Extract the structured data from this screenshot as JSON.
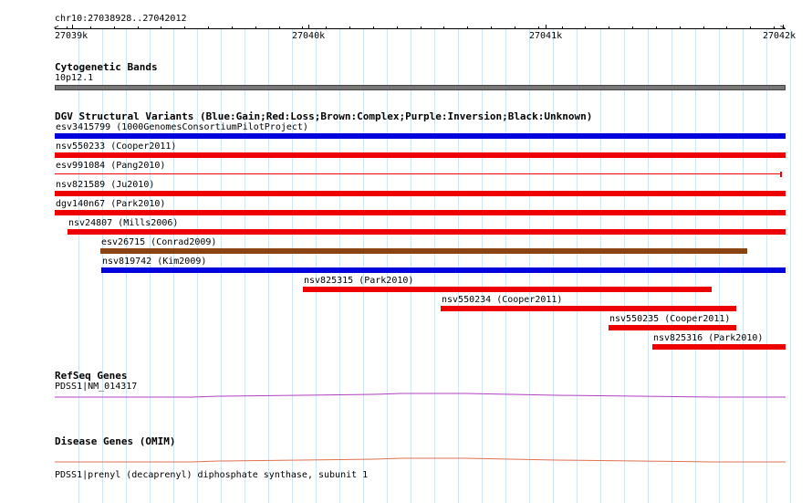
{
  "locus": "chr10:27038928..27042012",
  "ruler": {
    "ticks": [
      {
        "label": "27039k",
        "pos": 27039000
      },
      {
        "label": "27040k",
        "pos": 27040000
      },
      {
        "label": "27041k",
        "pos": 27041000
      },
      {
        "label": "27042k",
        "pos": 27042000
      }
    ],
    "start": 27038928,
    "end": 27042012
  },
  "cytobands": {
    "title": "Cytogenetic Bands",
    "band": "10p12.1",
    "color": "#777777"
  },
  "dgv": {
    "title": "DGV Structural Variants (Blue:Gain;Red:Loss;Brown:Complex;Purple:Inversion;Black:Unknown)",
    "colors": {
      "gain": "#0000dd",
      "loss": "#ee0000",
      "complex": "#8b4513"
    },
    "variants": [
      {
        "label": "esv3415799 (1000GenomesConsortiumPilotProject)",
        "type": "gain",
        "start": 27038928,
        "end": 27042012
      },
      {
        "label": "nsv550233 (Cooper2011)",
        "type": "loss",
        "start": 27038928,
        "end": 27042012
      },
      {
        "label": "esv991084 (Pang2010)",
        "type": "loss-thin",
        "start": 27038928,
        "end": 27041992
      },
      {
        "label": "nsv821589 (Ju2010)",
        "type": "loss",
        "start": 27038928,
        "end": 27042012
      },
      {
        "label": "dgv140n67 (Park2010)",
        "type": "loss",
        "start": 27038928,
        "end": 27042012
      },
      {
        "label": "nsv24807 (Mills2006)",
        "type": "loss",
        "start": 27038980,
        "end": 27042012
      },
      {
        "label": "esv26715 (Conrad2009)",
        "type": "complex",
        "start": 27039120,
        "end": 27041850
      },
      {
        "label": "nsv819742 (Kim2009)",
        "type": "gain",
        "start": 27039125,
        "end": 27042012
      },
      {
        "label": "nsv825315 (Park2010)",
        "type": "loss",
        "start": 27039975,
        "end": 27041700
      },
      {
        "label": "nsv550234 (Cooper2011)",
        "type": "loss",
        "start": 27040555,
        "end": 27041805
      },
      {
        "label": "nsv550235 (Cooper2011)",
        "type": "loss",
        "start": 27041265,
        "end": 27041805
      },
      {
        "label": "nsv825316 (Park2010)",
        "type": "loss",
        "start": 27041450,
        "end": 27042012
      }
    ]
  },
  "refseq": {
    "title": "RefSeq Genes",
    "gene": "PDSS1|NM_014317",
    "color": "#b040c0"
  },
  "omim": {
    "title": "Disease Genes (OMIM)",
    "gene": "PDSS1|prenyl (decaprenyl) diphosphate synthase, subunit 1",
    "color": "#e07050"
  }
}
